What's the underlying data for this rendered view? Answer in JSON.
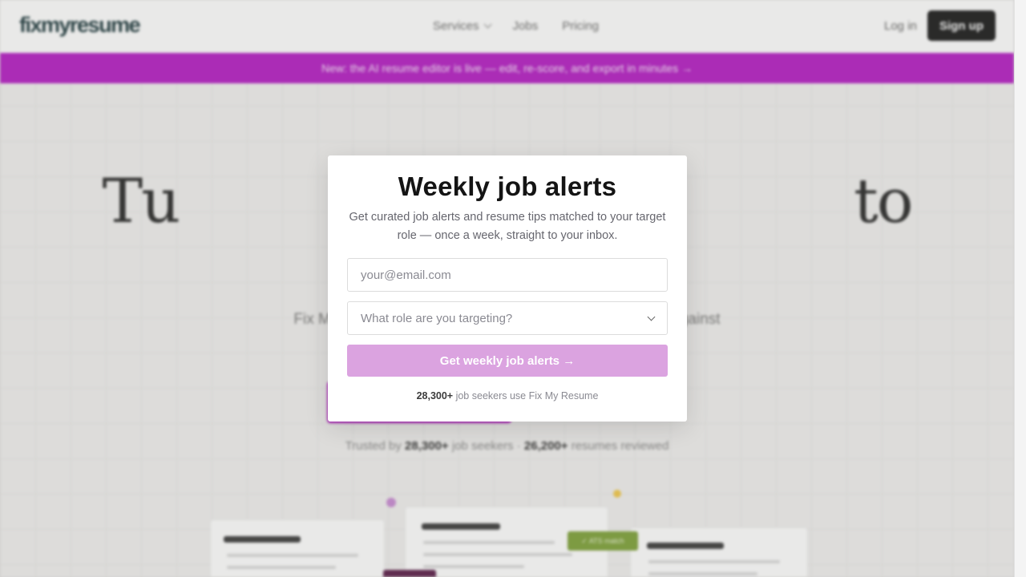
{
  "background": {
    "logo": "fixmyresume",
    "nav": [
      {
        "label": "Services",
        "has_dropdown": true
      },
      {
        "label": "Jobs",
        "has_dropdown": false
      },
      {
        "label": "Pricing",
        "has_dropdown": false
      }
    ],
    "login_label": "Log in",
    "signup_label": "Sign up",
    "promo_text": "New: the AI resume editor is live — edit, re-score, and export in minutes →",
    "hero_title": "Tu                                      to",
    "hero_subtitle": "Fix My                                                                   ating it against                                                                   ndows.",
    "trust_prefix": "Trusted by ",
    "trust_count_1": "28,300+",
    "trust_mid": " job seekers · ",
    "trust_count_2": "26,200+",
    "trust_suffix": " resumes reviewed",
    "tag_label": "✓ ATS match"
  },
  "modal": {
    "title": "Weekly job alerts",
    "description": "Get curated job alerts and resume tips matched to your target role — once a week, straight to your inbox.",
    "email_placeholder": "your@email.com",
    "email_value": "",
    "role_placeholder": "What role are you targeting?",
    "submit_label": "Get weekly job alerts →",
    "social_count": "28,300+",
    "social_text": " job seekers use Fix My Resume"
  },
  "colors": {
    "brand": "#b51ec4",
    "submit_disabled": "#dba3e0",
    "dark_button": "#1c1c1c",
    "green_tag": "#7fa23a"
  }
}
